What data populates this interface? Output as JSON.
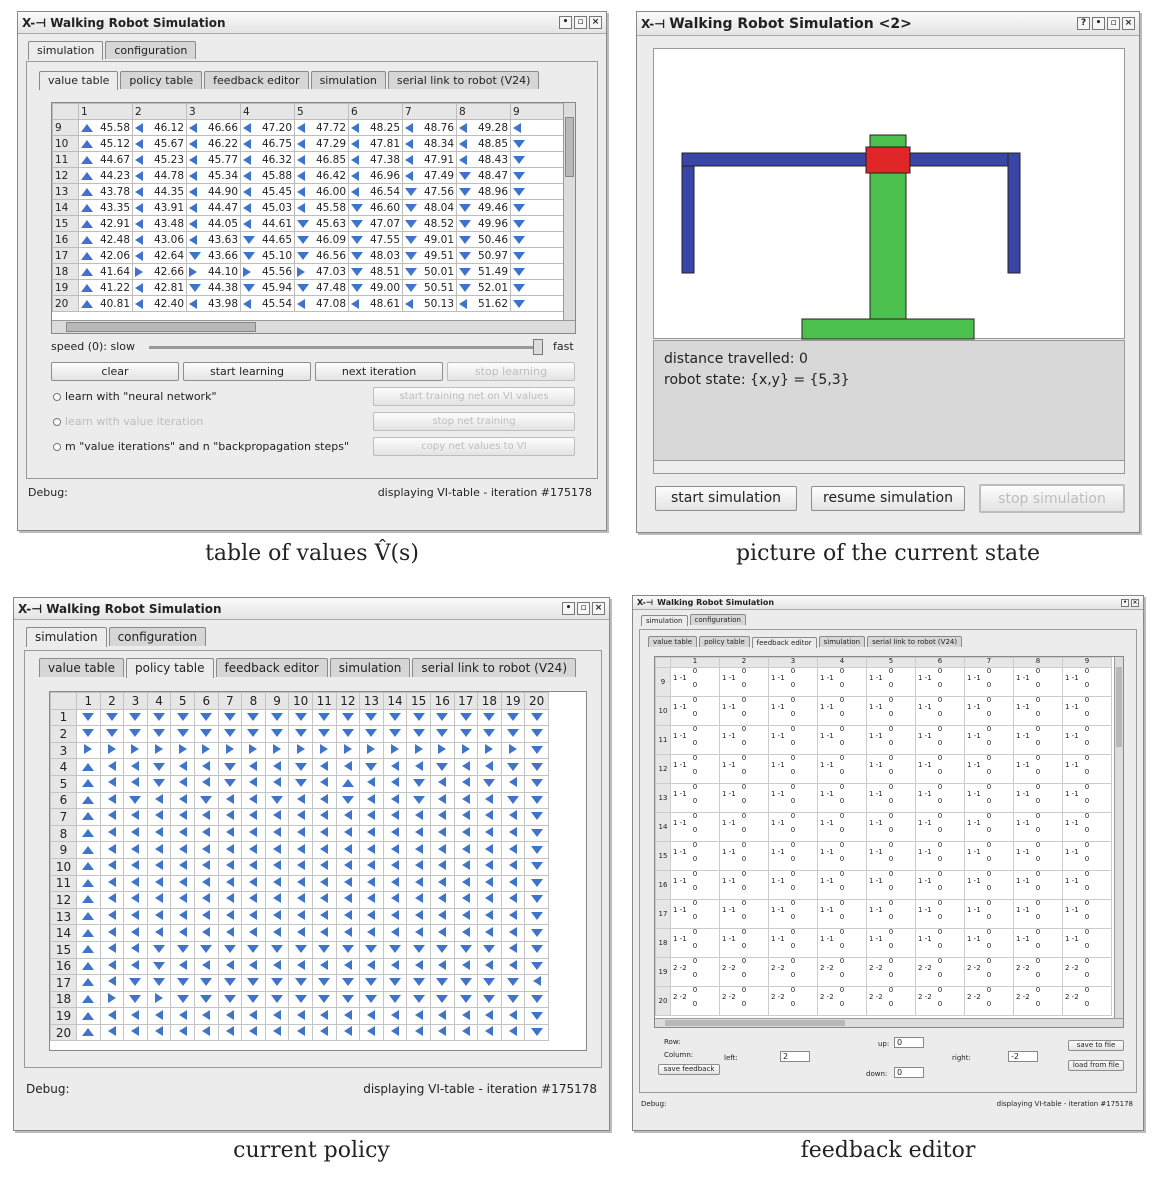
{
  "win_title": "Walking Robot Simulation",
  "win2_title": "Walking Robot Simulation <2>",
  "x_logo": "X-⊣",
  "main_tabs": [
    "simulation",
    "configuration"
  ],
  "sub_tabs": [
    "value table",
    "policy table",
    "feedback editor",
    "simulation",
    "serial link to robot (V24)"
  ],
  "value_table": {
    "columns": [
      "1",
      "2",
      "3",
      "4",
      "5",
      "6",
      "7",
      "8",
      "9"
    ],
    "rows": [
      {
        "r": "9",
        "cells": [
          [
            "u",
            "45.58"
          ],
          [
            "l",
            "46.12"
          ],
          [
            "l",
            "46.66"
          ],
          [
            "l",
            "47.20"
          ],
          [
            "l",
            "47.72"
          ],
          [
            "l",
            "48.25"
          ],
          [
            "l",
            "48.76"
          ],
          [
            "l",
            "49.28"
          ],
          [
            "l",
            ""
          ]
        ]
      },
      {
        "r": "10",
        "cells": [
          [
            "u",
            "45.12"
          ],
          [
            "l",
            "45.67"
          ],
          [
            "l",
            "46.22"
          ],
          [
            "l",
            "46.75"
          ],
          [
            "l",
            "47.29"
          ],
          [
            "l",
            "47.81"
          ],
          [
            "l",
            "48.34"
          ],
          [
            "l",
            "48.85"
          ],
          [
            "d",
            ""
          ]
        ]
      },
      {
        "r": "11",
        "cells": [
          [
            "u",
            "44.67"
          ],
          [
            "l",
            "45.23"
          ],
          [
            "l",
            "45.77"
          ],
          [
            "l",
            "46.32"
          ],
          [
            "l",
            "46.85"
          ],
          [
            "l",
            "47.38"
          ],
          [
            "l",
            "47.91"
          ],
          [
            "l",
            "48.43"
          ],
          [
            "d",
            ""
          ]
        ]
      },
      {
        "r": "12",
        "cells": [
          [
            "u",
            "44.23"
          ],
          [
            "l",
            "44.78"
          ],
          [
            "l",
            "45.34"
          ],
          [
            "l",
            "45.88"
          ],
          [
            "l",
            "46.42"
          ],
          [
            "l",
            "46.96"
          ],
          [
            "l",
            "47.49"
          ],
          [
            "d",
            "48.47"
          ],
          [
            "d",
            ""
          ]
        ]
      },
      {
        "r": "13",
        "cells": [
          [
            "u",
            "43.78"
          ],
          [
            "l",
            "44.35"
          ],
          [
            "l",
            "44.90"
          ],
          [
            "l",
            "45.45"
          ],
          [
            "l",
            "46.00"
          ],
          [
            "l",
            "46.54"
          ],
          [
            "d",
            "47.56"
          ],
          [
            "d",
            "48.96"
          ],
          [
            "d",
            ""
          ]
        ]
      },
      {
        "r": "14",
        "cells": [
          [
            "u",
            "43.35"
          ],
          [
            "l",
            "43.91"
          ],
          [
            "l",
            "44.47"
          ],
          [
            "l",
            "45.03"
          ],
          [
            "l",
            "45.58"
          ],
          [
            "d",
            "46.60"
          ],
          [
            "d",
            "48.04"
          ],
          [
            "d",
            "49.46"
          ],
          [
            "d",
            ""
          ]
        ]
      },
      {
        "r": "15",
        "cells": [
          [
            "u",
            "42.91"
          ],
          [
            "l",
            "43.48"
          ],
          [
            "l",
            "44.05"
          ],
          [
            "l",
            "44.61"
          ],
          [
            "d",
            "45.63"
          ],
          [
            "d",
            "47.07"
          ],
          [
            "d",
            "48.52"
          ],
          [
            "d",
            "49.96"
          ],
          [
            "d",
            ""
          ]
        ]
      },
      {
        "r": "16",
        "cells": [
          [
            "u",
            "42.48"
          ],
          [
            "l",
            "43.06"
          ],
          [
            "l",
            "43.63"
          ],
          [
            "d",
            "44.65"
          ],
          [
            "d",
            "46.09"
          ],
          [
            "d",
            "47.55"
          ],
          [
            "d",
            "49.01"
          ],
          [
            "d",
            "50.46"
          ],
          [
            "d",
            ""
          ]
        ]
      },
      {
        "r": "17",
        "cells": [
          [
            "u",
            "42.06"
          ],
          [
            "l",
            "42.64"
          ],
          [
            "d",
            "43.66"
          ],
          [
            "d",
            "45.10"
          ],
          [
            "d",
            "46.56"
          ],
          [
            "d",
            "48.03"
          ],
          [
            "d",
            "49.51"
          ],
          [
            "d",
            "50.97"
          ],
          [
            "d",
            ""
          ]
        ]
      },
      {
        "r": "18",
        "cells": [
          [
            "u",
            "41.64"
          ],
          [
            "r",
            "42.66"
          ],
          [
            "r",
            "44.10"
          ],
          [
            "r",
            "45.56"
          ],
          [
            "r",
            "47.03"
          ],
          [
            "d",
            "48.51"
          ],
          [
            "d",
            "50.01"
          ],
          [
            "d",
            "51.49"
          ],
          [
            "d",
            ""
          ]
        ]
      },
      {
        "r": "19",
        "cells": [
          [
            "u",
            "41.22"
          ],
          [
            "l",
            "42.81"
          ],
          [
            "d",
            "44.38"
          ],
          [
            "d",
            "45.94"
          ],
          [
            "d",
            "47.48"
          ],
          [
            "d",
            "49.00"
          ],
          [
            "d",
            "50.51"
          ],
          [
            "d",
            "52.01"
          ],
          [
            "d",
            ""
          ]
        ]
      },
      {
        "r": "20",
        "cells": [
          [
            "u",
            "40.81"
          ],
          [
            "l",
            "42.40"
          ],
          [
            "l",
            "43.98"
          ],
          [
            "l",
            "45.54"
          ],
          [
            "l",
            "47.08"
          ],
          [
            "l",
            "48.61"
          ],
          [
            "l",
            "50.13"
          ],
          [
            "l",
            "51.62"
          ],
          [
            "d",
            ""
          ]
        ]
      }
    ]
  },
  "speed_label": "speed (0): slow",
  "speed_fast": "fast",
  "buttons": {
    "clear": "clear",
    "start_learning": "start learning",
    "next_iteration": "next iteration",
    "stop_learning": "stop learning",
    "start_training": "start training net on VI values",
    "stop_net_training": "stop net training",
    "copy_net": "copy net values to VI"
  },
  "radios": {
    "neural": "learn with \"neural network\"",
    "value_iter": "learn with value iteration",
    "mixed": "m \"value iterations\" and n \"backpropagation steps\""
  },
  "debug_label": "Debug:",
  "status_text": "displaying VI-table - iteration #175178",
  "sim2": {
    "distance": "distance travelled: 0",
    "state": "robot state: {x,y} = {5,3}",
    "start": "start simulation",
    "resume": "resume simulation",
    "stop": "stop simulation"
  },
  "policy_table": {
    "columns": [
      "1",
      "2",
      "3",
      "4",
      "5",
      "6",
      "7",
      "8",
      "9",
      "10",
      "11",
      "12",
      "13",
      "14",
      "15",
      "16",
      "17",
      "18",
      "19",
      "20"
    ],
    "rows": [
      "dddddddddddddddddddd",
      "dddddddddddddddddddd",
      "rrrrrrrrrrrrrrrrrrrd",
      "ulldlldlldlldlldlldd",
      "ulldlldlldlulldlldld",
      "uldlldlldlldlldllldd",
      "ulllllllllllllllllld",
      "ulllllllllllllllllld",
      "ulllllllllllllllllld",
      "ulllllllllllllllllld",
      "ulllllllllllllllllld",
      "ulllllllllllllllllld",
      "ulllllllllllllllllld",
      "ulllllllllllllllllld",
      "ulldddddddddddddddld",
      "ulldllllllllllllllld",
      "ulddddddddddddddddd",
      "urdrdddddddddddddddd",
      "ulllllllllllllllllld",
      "ulllllllllllllllllld"
    ]
  },
  "feedback": {
    "columns": [
      "1",
      "2",
      "3",
      "4",
      "5",
      "6",
      "7",
      "8",
      "9"
    ],
    "rows": [
      "9",
      "10",
      "11",
      "12",
      "13",
      "14",
      "15",
      "16",
      "17",
      "18",
      "19",
      "20"
    ],
    "cell_top": "0",
    "cell_mid": "1  -1",
    "cell_mid_last": "2  -2",
    "cell_bot": "0",
    "row_label": "Row:",
    "column_label": "Column:",
    "left_label": "left:",
    "up_label": "up:",
    "right_label": "right:",
    "down_label": "down:",
    "left_val": "2",
    "up_val": "0",
    "right_val": "-2",
    "down_val": "0",
    "save_feedback": "save feedback",
    "save_file": "save to file",
    "load_file": "load from file"
  },
  "captions": {
    "value": "table of values V̂(s)",
    "picture": "picture of the current state",
    "policy": "current policy",
    "feedback": "feedback editor"
  }
}
